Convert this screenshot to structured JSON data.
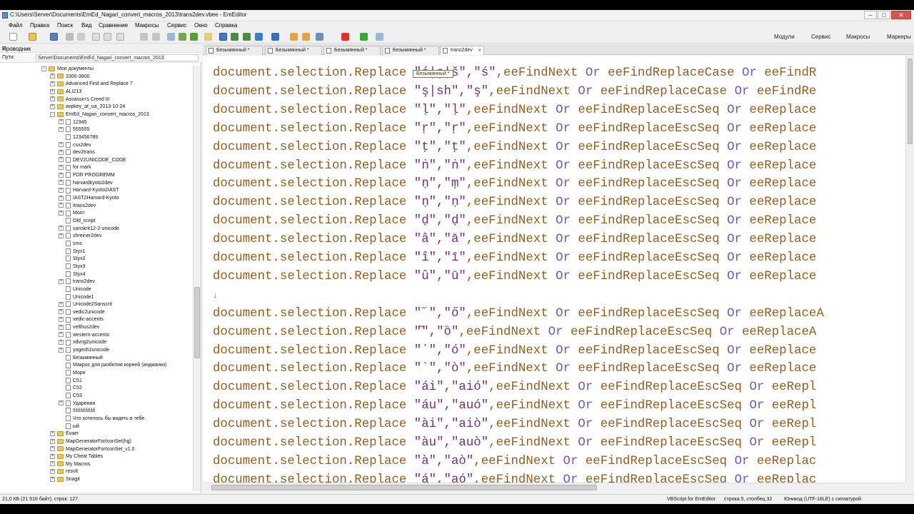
{
  "window": {
    "title": "C:\\Users\\Server\\Documents\\EmEd_Nagari_convert_macros_2013\\trans2dev.vbee - EmEditor",
    "minimize": "–",
    "maximize": "□",
    "close": "✕"
  },
  "menu": [
    "Файл",
    "Правка",
    "Поиск",
    "Вид",
    "Сравнение",
    "Макросы",
    "Сервис",
    "Окно",
    "Справка"
  ],
  "toolbar_right": [
    "Модули",
    "Сервис",
    "Макросы",
    "Маркеры"
  ],
  "sidebar": {
    "title": "Проводник",
    "close": "×",
    "path_label": "Пути:",
    "path_value": "Server\\Documents\\EmEd_Nagari_convert_macros_2013",
    "tree": [
      {
        "label": "Мои документы",
        "level": 0,
        "type": "folder",
        "expander": "-"
      },
      {
        "label": "3300-3800",
        "level": 1,
        "type": "folder",
        "expander": "+"
      },
      {
        "label": "Advanced Find and Replace 7",
        "level": 1,
        "type": "folder",
        "expander": "+"
      },
      {
        "label": "ALI213",
        "level": 1,
        "type": "folder",
        "expander": "+"
      },
      {
        "label": "Assassin's Creed III",
        "level": 1,
        "type": "folder",
        "expander": "+"
      },
      {
        "label": "avpkey_at_ua_2013-10-24",
        "level": 1,
        "type": "folder",
        "expander": "+"
      },
      {
        "label": "EmEd_Nagari_convert_macros_2013",
        "level": 1,
        "type": "folder",
        "expander": "-"
      },
      {
        "label": "12345",
        "level": 2,
        "type": "file",
        "expander": "+"
      },
      {
        "label": "555555",
        "level": 2,
        "type": "file",
        "expander": "+"
      },
      {
        "label": "123456789",
        "level": 2,
        "type": "file",
        "expander": ""
      },
      {
        "label": "csx2dev",
        "level": 2,
        "type": "file",
        "expander": "+"
      },
      {
        "label": "dev2trans",
        "level": 2,
        "type": "file",
        "expander": "+"
      },
      {
        "label": "DEV2UNICODE_CODE",
        "level": 2,
        "type": "file",
        "expander": "+"
      },
      {
        "label": "for mark",
        "level": 2,
        "type": "file",
        "expander": "+"
      },
      {
        "label": "FOR PROGREMM",
        "level": 2,
        "type": "file",
        "expander": "+"
      },
      {
        "label": "harvardkyoto2dev",
        "level": 2,
        "type": "file",
        "expander": "+"
      },
      {
        "label": "Harvard-Kyoto2IAST",
        "level": 2,
        "type": "file",
        "expander": "+"
      },
      {
        "label": "IAST2Harvard-Kyoto",
        "level": 2,
        "type": "file",
        "expander": "+"
      },
      {
        "label": "itrans2dev",
        "level": 2,
        "type": "file",
        "expander": "+"
      },
      {
        "label": "Morrr",
        "level": 2,
        "type": "file",
        "expander": "+"
      },
      {
        "label": "Old_script",
        "level": 2,
        "type": "file",
        "expander": ""
      },
      {
        "label": "sanskrit12-2-unicode",
        "level": 2,
        "type": "file",
        "expander": "+"
      },
      {
        "label": "shreiner2dev",
        "level": 2,
        "type": "file",
        "expander": "+"
      },
      {
        "label": "sms",
        "level": 2,
        "type": "file",
        "expander": ""
      },
      {
        "label": "Styx1",
        "level": 2,
        "type": "file",
        "expander": ""
      },
      {
        "label": "Styx2",
        "level": 2,
        "type": "file",
        "expander": ""
      },
      {
        "label": "Styx3",
        "level": 2,
        "type": "file",
        "expander": ""
      },
      {
        "label": "Styx4",
        "level": 2,
        "type": "file",
        "expander": ""
      },
      {
        "label": "trans2dev",
        "level": 2,
        "type": "file",
        "expander": "+"
      },
      {
        "label": "Unicode",
        "level": 2,
        "type": "file",
        "expander": ""
      },
      {
        "label": "Unicode1",
        "level": 2,
        "type": "file",
        "expander": ""
      },
      {
        "label": "Unicode2Sanscrit",
        "level": 2,
        "type": "file",
        "expander": "+"
      },
      {
        "label": "vedic2unicode",
        "level": 2,
        "type": "file",
        "expander": "+"
      },
      {
        "label": "vedic-accents",
        "level": 2,
        "type": "file",
        "expander": "+"
      },
      {
        "label": "velthus2dev",
        "level": 2,
        "type": "file",
        "expander": "+"
      },
      {
        "label": "western-accents",
        "level": 2,
        "type": "file",
        "expander": "+"
      },
      {
        "label": "xdvng2unicode",
        "level": 2,
        "type": "file",
        "expander": "+"
      },
      {
        "label": "yogesh2unicode",
        "level": 2,
        "type": "file",
        "expander": "+"
      },
      {
        "label": "Безымянный",
        "level": 2,
        "type": "file",
        "expander": ""
      },
      {
        "label": "Макрос для разбития корней (индианки)",
        "level": 2,
        "type": "file",
        "expander": ""
      },
      {
        "label": "Море",
        "level": 2,
        "type": "file",
        "expander": ""
      },
      {
        "label": "С51",
        "level": 2,
        "type": "file",
        "expander": ""
      },
      {
        "label": "С52",
        "level": 2,
        "type": "file",
        "expander": ""
      },
      {
        "label": "С53",
        "level": 2,
        "type": "file",
        "expander": ""
      },
      {
        "label": "Ударения",
        "level": 2,
        "type": "file",
        "expander": "+"
      },
      {
        "label": "ššššššššš",
        "level": 2,
        "type": "file",
        "expander": ""
      },
      {
        "label": "Что хотелось бы видеть в тебе",
        "level": 2,
        "type": "file",
        "expander": ""
      },
      {
        "label": "ый",
        "level": 2,
        "type": "file",
        "expander": ""
      },
      {
        "label": "Evaer",
        "level": 1,
        "type": "folder",
        "expander": "+"
      },
      {
        "label": "MapGeneratorForIconSet(hg)",
        "level": 1,
        "type": "folder",
        "expander": "+"
      },
      {
        "label": "MapGeneratorForIconSet_v1.0",
        "level": 1,
        "type": "folder",
        "expander": "+"
      },
      {
        "label": "My Cheat Tables",
        "level": 1,
        "type": "folder",
        "expander": "+"
      },
      {
        "label": "My Macros",
        "level": 1,
        "type": "folder",
        "expander": "+"
      },
      {
        "label": "result",
        "level": 1,
        "type": "folder",
        "expander": "+"
      },
      {
        "label": "Snagit",
        "level": 1,
        "type": "folder",
        "expander": "+"
      }
    ]
  },
  "tabs": [
    {
      "label": "Безымянный *",
      "active": false
    },
    {
      "label": "Безымянный *",
      "active": false
    },
    {
      "label": "Безымянный *",
      "active": false
    },
    {
      "label": "Безымянный *",
      "active": false
    },
    {
      "label": "trans2dev",
      "active": true
    }
  ],
  "tab_close": "×",
  "tooltip": "Безымянный *",
  "editor": {
    "caret_mark": "↓",
    "lines": [
      {
        "k": "document.selection.Replace ",
        "s": "\"ś|ç|š\",\"ś\"",
        "r": ",eeFindNext Or eeFindReplaceCase Or eeFindR"
      },
      {
        "k": "document.selection.Replace ",
        "s": "\"ş|sh\",\"ş\"",
        "r": ",eeFindNext Or eeFindReplaceCase Or eeFindRe"
      },
      {
        "k": "document.selection.Replace ",
        "s": "\"ḷ\",\"ḷ\"",
        "r": ",eeFindNext Or eeFindReplaceEscSeq Or eeReplace"
      },
      {
        "k": "document.selection.Replace ",
        "s": "\"ṛ\",\"ṛ\"",
        "r": ",eeFindNext Or eeFindReplaceEscSeq Or eeReplace"
      },
      {
        "k": "document.selection.Replace ",
        "s": "\"ṭ\",\"ṭ\"",
        "r": ",eeFindNext Or eeFindReplaceEscSeq Or eeReplace"
      },
      {
        "k": "document.selection.Replace ",
        "s": "\"ṅ\",\"ṅ\"",
        "r": ",eeFindNext Or eeFindReplaceEscSeq Or eeReplace"
      },
      {
        "k": "document.selection.Replace ",
        "s": "\"ṇ\",\"ṃ\"",
        "r": ",eeFindNext Or eeFindReplaceEscSeq Or eeReplace"
      },
      {
        "k": "document.selection.Replace ",
        "s": "\"ṇ\",\"ṇ\"",
        "r": ",eeFindNext Or eeFindReplaceEscSeq Or eeReplace"
      },
      {
        "k": "document.selection.Replace ",
        "s": "\"ḍ\",\"ḍ\"",
        "r": ",eeFindNext Or eeFindReplaceEscSeq Or eeReplace"
      },
      {
        "k": "document.selection.Replace ",
        "s": "\"â\",\"ā\"",
        "r": ",eeFindNext Or eeFindReplaceEscSeq Or eeReplace"
      },
      {
        "k": "document.selection.Replace ",
        "s": "\"î\",\"ī\"",
        "r": ",eeFindNext Or eeFindReplaceEscSeq Or eeReplace"
      },
      {
        "k": "document.selection.Replace ",
        "s": "\"û\",\"ū\"",
        "r": ",eeFindNext Or eeFindReplaceEscSeq Or eeReplace"
      },
      {
        "k": "",
        "s": "",
        "r": ""
      },
      {
        "k": "document.selection.Replace ",
        "s": "\"˝\",\"ő\"",
        "r": ",eeFindNext Or eeFindReplaceEscSeq Or eeReplaceA"
      },
      {
        "k": "document.selection.Replace ",
        "s": "\"̏\",\"ȍ\"",
        "r": ",eeFindNext Or eeFindReplaceEscSeq Or eeReplaceA"
      },
      {
        "k": "document.selection.Replace ",
        "s": "\"´\",\"ó\"",
        "r": ",eeFindNext Or eeFindReplaceEscSeq Or eeReplace"
      },
      {
        "k": "document.selection.Replace ",
        "s": "\"`\",\"ò\"",
        "r": ",eeFindNext Or eeFindReplaceEscSeq Or eeReplace"
      },
      {
        "k": "document.selection.Replace ",
        "s": "\"ái\",\"aió\"",
        "r": ",eeFindNext Or eeFindReplaceEscSeq Or eeRepl"
      },
      {
        "k": "document.selection.Replace ",
        "s": "\"áu\",\"auó\"",
        "r": ",eeFindNext Or eeFindReplaceEscSeq Or eeRepl"
      },
      {
        "k": "document.selection.Replace ",
        "s": "\"ài\",\"aiò\"",
        "r": ",eeFindNext Or eeFindReplaceEscSeq Or eeRepl"
      },
      {
        "k": "document.selection.Replace ",
        "s": "\"àu\",\"auò\"",
        "r": ",eeFindNext Or eeFindReplaceEscSeq Or eeRepl"
      },
      {
        "k": "document.selection.Replace ",
        "s": "\"à\",\"aò\"",
        "r": ",eeFindNext Or eeFindReplaceEscSeq Or eeReplac"
      },
      {
        "k": "document.selection.Replace ",
        "s": "\"á\",\"aó\"",
        "r": ",eeFindNext Or eeFindReplaceEscSeq Or eeReplac"
      }
    ]
  },
  "status": {
    "left": "21,0 КБ (21 516 байт), строк: 127.",
    "language": "VBScript for EmEditor",
    "position": "строка 5, столбец 32",
    "encoding": "Юникод (UTF-16LE) с сигнатурой"
  },
  "colors": {
    "keyword": "#9a5c1c",
    "string": "#7b2d7b",
    "operator": "#6e4aa0"
  }
}
